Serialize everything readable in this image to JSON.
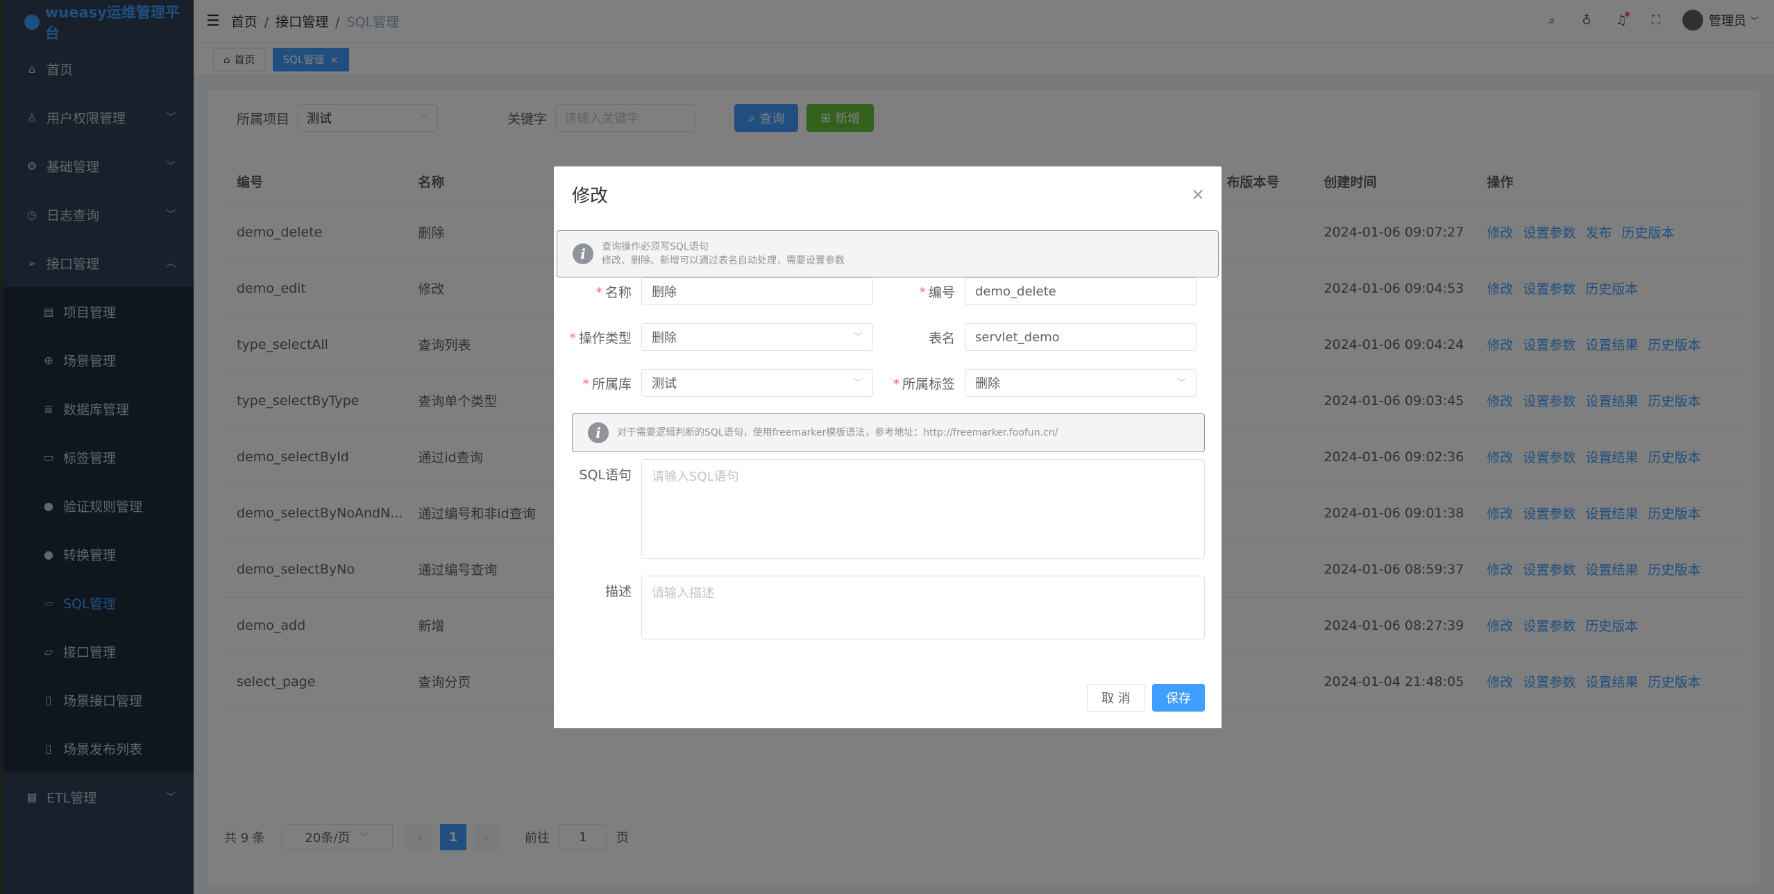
{
  "app": {
    "title": "wueasy运维管理平台"
  },
  "sidebar": {
    "items": [
      {
        "label": "首页",
        "icon": "home-icon",
        "glyph": "⌂"
      },
      {
        "label": "用户权限管理",
        "icon": "user-icon",
        "glyph": "♙",
        "expandable": true
      },
      {
        "label": "基础管理",
        "icon": "gear-icon",
        "glyph": "⚙",
        "expandable": true
      },
      {
        "label": "日志查询",
        "icon": "clock-icon",
        "glyph": "◷",
        "expandable": true
      },
      {
        "label": "接口管理",
        "icon": "send-icon",
        "glyph": "➢",
        "expandable": true,
        "expanded": true
      }
    ],
    "subitems": [
      {
        "label": "项目管理",
        "icon": "clipboard-icon",
        "glyph": "▤"
      },
      {
        "label": "场景管理",
        "icon": "compass-icon",
        "glyph": "⊕"
      },
      {
        "label": "数据库管理",
        "icon": "database-icon",
        "glyph": "≣"
      },
      {
        "label": "标签管理",
        "icon": "tag-icon",
        "glyph": "▭"
      },
      {
        "label": "验证规则管理",
        "icon": "location-icon",
        "glyph": "●"
      },
      {
        "label": "转换管理",
        "icon": "location-icon",
        "glyph": "●"
      },
      {
        "label": "SQL管理",
        "icon": "folder-icon",
        "glyph": "▱",
        "active": true
      },
      {
        "label": "接口管理",
        "icon": "folder-icon",
        "glyph": "▱"
      },
      {
        "label": "场景接口管理",
        "icon": "document-icon",
        "glyph": "▯"
      },
      {
        "label": "场景发布列表",
        "icon": "document-icon",
        "glyph": "▯"
      }
    ],
    "bottom": {
      "label": "ETL管理",
      "icon": "calendar-icon",
      "glyph": "▦"
    }
  },
  "header": {
    "breadcrumb": [
      "首页",
      "接口管理",
      "SQL管理"
    ],
    "user": "管理员"
  },
  "tags": [
    {
      "label": "首页"
    },
    {
      "label": "SQL管理",
      "close": "×"
    }
  ],
  "filter": {
    "project_label": "所属项目",
    "project_value": "测试",
    "keyword_label": "关键字",
    "keyword_placeholder": "请输入关键字",
    "query_label": "查询",
    "add_label": "新增"
  },
  "table": {
    "headers": [
      "编号",
      "名称",
      "布版本号",
      "创建时间",
      "操作"
    ],
    "rows": [
      {
        "code": "demo_delete",
        "name": "删除",
        "time": "2024-01-06 09:07:27",
        "ops": [
          "修改",
          "设置参数",
          "发布",
          "历史版本"
        ]
      },
      {
        "code": "demo_edit",
        "name": "修改",
        "time": "2024-01-06 09:04:53",
        "ops": [
          "修改",
          "设置参数",
          "历史版本"
        ]
      },
      {
        "code": "type_selectAll",
        "name": "查询列表",
        "time": "2024-01-06 09:04:24",
        "ops": [
          "修改",
          "设置参数",
          "设置结果",
          "历史版本"
        ]
      },
      {
        "code": "type_selectByType",
        "name": "查询单个类型",
        "time": "2024-01-06 09:03:45",
        "ops": [
          "修改",
          "设置参数",
          "设置结果",
          "历史版本"
        ]
      },
      {
        "code": "demo_selectById",
        "name": "通过id查询",
        "time": "2024-01-06 09:02:36",
        "ops": [
          "修改",
          "设置参数",
          "设置结果",
          "历史版本"
        ]
      },
      {
        "code": "demo_selectByNoAndN...",
        "name": "通过编号和非id查询",
        "time": "2024-01-06 09:01:38",
        "ops": [
          "修改",
          "设置参数",
          "设置结果",
          "历史版本"
        ]
      },
      {
        "code": "demo_selectByNo",
        "name": "通过编号查询",
        "time": "2024-01-06 08:59:37",
        "ops": [
          "修改",
          "设置参数",
          "设置结果",
          "历史版本"
        ]
      },
      {
        "code": "demo_add",
        "name": "新增",
        "time": "2024-01-06 08:27:39",
        "ops": [
          "修改",
          "设置参数",
          "历史版本"
        ]
      },
      {
        "code": "select_page",
        "name": "查询分页",
        "time": "2024-01-04 21:48:05",
        "ops": [
          "修改",
          "设置参数",
          "设置结果",
          "历史版本"
        ]
      }
    ]
  },
  "pagination": {
    "total": "共 9 条",
    "page_size": "20条/页",
    "prev": "‹",
    "current": "1",
    "next": "›",
    "goto_label": "前往",
    "goto_value": "1",
    "page_suffix": "页"
  },
  "dialog": {
    "title": "修改",
    "close": "×",
    "alert1_line1": "查询操作必须写SQL语句",
    "alert1_line2": "修改、删除、新增可以通过表名自动处理，需要设置参数",
    "fields": {
      "name_label": "名称",
      "name_value": "删除",
      "code_label": "编号",
      "code_value": "demo_delete",
      "optype_label": "操作类型",
      "optype_value": "删除",
      "table_label": "表名",
      "table_value": "servlet_demo",
      "db_label": "所属库",
      "db_value": "测试",
      "tag_label": "所属标签",
      "tag_value": "删除",
      "sql_label": "SQL语句",
      "sql_placeholder": "请输入SQL语句",
      "desc_label": "描述",
      "desc_placeholder": "请输入描述"
    },
    "alert2": "对于需要逻辑判断的SQL语句，使用freemarker模板语法，参考地址：http://freemarker.foofun.cn/",
    "cancel_label": "取 消",
    "save_label": "保存"
  }
}
